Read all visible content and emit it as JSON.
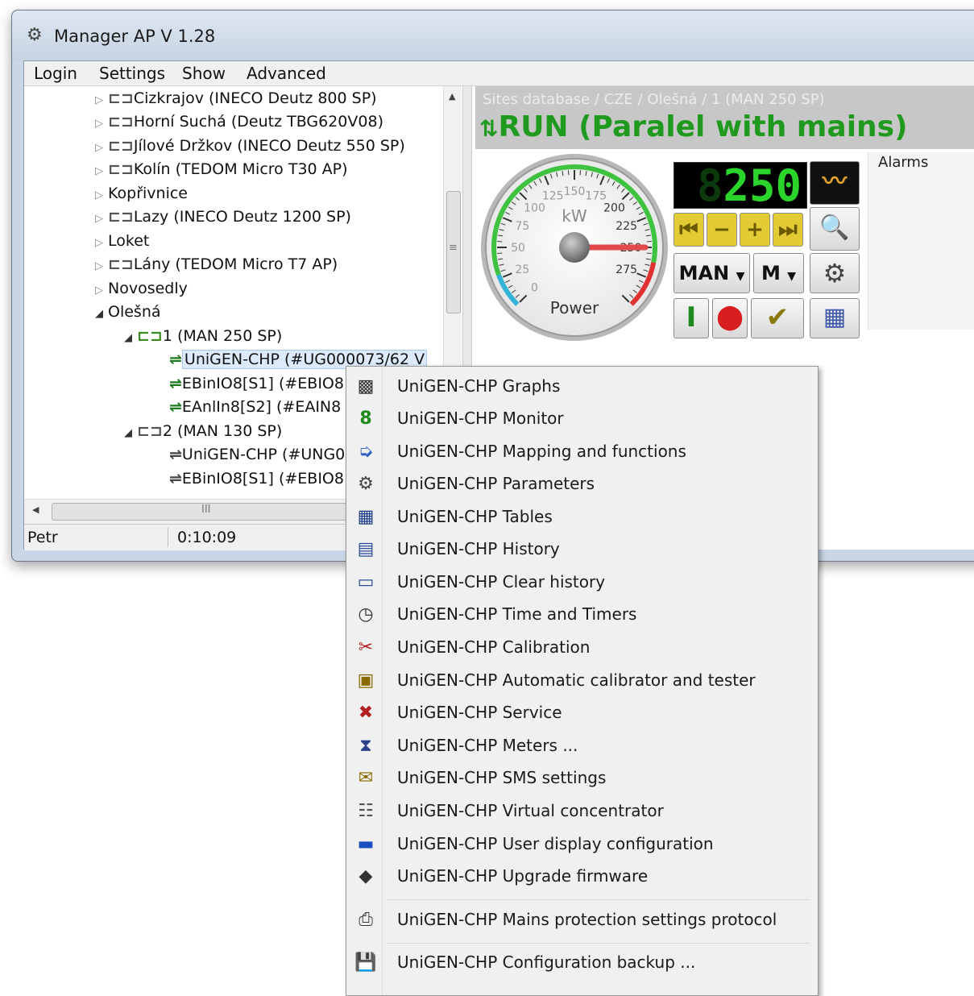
{
  "window": {
    "title": "Manager AP   V 1.28",
    "app_icon": "gear-computer-icon"
  },
  "menubar": {
    "items": [
      "Login",
      "Settings",
      "Show",
      "Advanced"
    ]
  },
  "tree": {
    "nodes": [
      {
        "label": "Cizkrajov (INECO Deutz 800 SP)"
      },
      {
        "label": "Horní Suchá (Deutz TBG620V08)"
      },
      {
        "label": "Jílové Držkov (INECO Deutz 550 SP)"
      },
      {
        "label": "Kolín (TEDOM Micro T30 AP)"
      },
      {
        "label": "Kopřivnice"
      },
      {
        "label": "Lazy (INECO Deutz 1200 SP)"
      },
      {
        "label": "Loket"
      },
      {
        "label": "Lány (TEDOM Micro T7 AP)"
      },
      {
        "label": "Novosedly"
      },
      {
        "label": "Olešná"
      },
      {
        "label": "1 (MAN 250 SP)"
      },
      {
        "label": "UniGEN-CHP (#UG000073/62  V"
      },
      {
        "label": "EBinIO8[S1] (#EBIO8"
      },
      {
        "label": "EAnlIn8[S2] (#EAIN8"
      },
      {
        "label": "2 (MAN 130 SP)"
      },
      {
        "label": "UniGEN-CHP (#UNG0("
      },
      {
        "label": "EBinIO8[S1] (#EBIO8"
      }
    ],
    "hscroll_mark": "III",
    "vscroll_mark": "≡"
  },
  "status": {
    "user": "Petr",
    "time": "0:10:09"
  },
  "panel": {
    "breadcrumb": "Sites database / CZE / Olešná / 1 (MAN 250 SP)",
    "state": "RUN (Paralel with mains)",
    "state_icon": "sync-arrows-icon",
    "gauge": {
      "unit": "kW",
      "label": "Power",
      "value": 250,
      "ticks": [
        "0",
        "25",
        "50",
        "75",
        "100",
        "125",
        "150",
        "175",
        "200",
        "225",
        "250",
        "275"
      ]
    },
    "digital_value": "250",
    "mode_select": "MAN",
    "m_select": "M",
    "alarms_label": "Alarms",
    "colors": {
      "run": "#1f9a1f",
      "digits": "#2bd42b",
      "needle": "#e04040"
    }
  },
  "context_menu": {
    "items": [
      {
        "label": "UniGEN-CHP Graphs",
        "icon": "graph-icon"
      },
      {
        "label": "UniGEN-CHP Monitor",
        "icon": "monitor-digit-icon"
      },
      {
        "label": "UniGEN-CHP Mapping and functions",
        "icon": "mapping-icon"
      },
      {
        "label": "UniGEN-CHP Parameters",
        "icon": "parameters-icon"
      },
      {
        "label": "UniGEN-CHP Tables",
        "icon": "table-icon"
      },
      {
        "label": "UniGEN-CHP History",
        "icon": "history-icon"
      },
      {
        "label": "UniGEN-CHP Clear history",
        "icon": "clear-history-icon"
      },
      {
        "label": "UniGEN-CHP Time and Timers",
        "icon": "clock-icon"
      },
      {
        "label": "UniGEN-CHP Calibration",
        "icon": "calibration-icon"
      },
      {
        "label": "UniGEN-CHP Automatic calibrator and tester",
        "icon": "calibrator-icon"
      },
      {
        "label": "UniGEN-CHP Service",
        "icon": "service-tools-icon"
      },
      {
        "label": "UniGEN-CHP Meters ...",
        "icon": "hourglass-icon"
      },
      {
        "label": "UniGEN-CHP SMS settings",
        "icon": "envelope-icon"
      },
      {
        "label": "UniGEN-CHP Virtual concentrator",
        "icon": "concentrator-icon"
      },
      {
        "label": "UniGEN-CHP User display configuration",
        "icon": "display-config-icon"
      },
      {
        "label": "UniGEN-CHP Upgrade firmware",
        "icon": "chip-icon"
      },
      {
        "label": "UniGEN-CHP Mains protection settings protocol",
        "icon": "printer-icon"
      },
      {
        "label": "UniGEN-CHP Configuration backup ...",
        "icon": "floppy-disk-icon"
      }
    ]
  }
}
